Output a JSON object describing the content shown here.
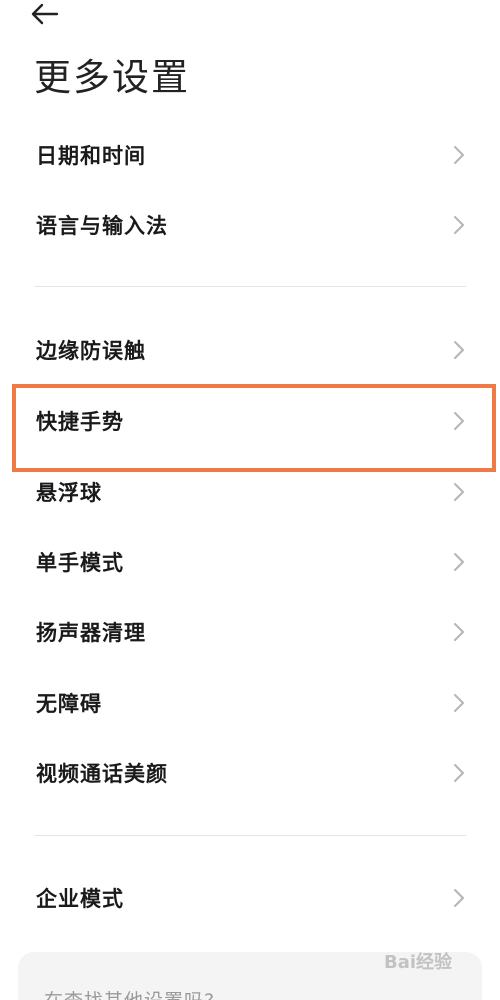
{
  "header": {
    "back_icon": "back-arrow-icon",
    "title": "更多设置"
  },
  "group1": [
    {
      "label": "日期和时间",
      "icon": "chevron-right-icon"
    },
    {
      "label": "语言与输入法",
      "icon": "chevron-right-icon"
    }
  ],
  "group2": [
    {
      "label": "边缘防误触",
      "icon": "chevron-right-icon"
    },
    {
      "label": "快捷手势",
      "icon": "chevron-right-icon",
      "highlighted": true
    },
    {
      "label": "悬浮球",
      "icon": "chevron-right-icon"
    },
    {
      "label": "单手模式",
      "icon": "chevron-right-icon"
    },
    {
      "label": "扬声器清理",
      "icon": "chevron-right-icon"
    },
    {
      "label": "无障碍",
      "icon": "chevron-right-icon"
    },
    {
      "label": "视频通话美颜",
      "icon": "chevron-right-icon"
    }
  ],
  "group3": [
    {
      "label": "企业模式",
      "icon": "chevron-right-icon"
    }
  ],
  "suggestion": {
    "text": "在查找其他设置吗?"
  },
  "watermark": {
    "text": "Bai经验"
  },
  "colors": {
    "highlight": "#ef7a45",
    "chevron": "#b5b5b5",
    "divider": "#e6e6e6",
    "card": "#f4f4f4"
  }
}
